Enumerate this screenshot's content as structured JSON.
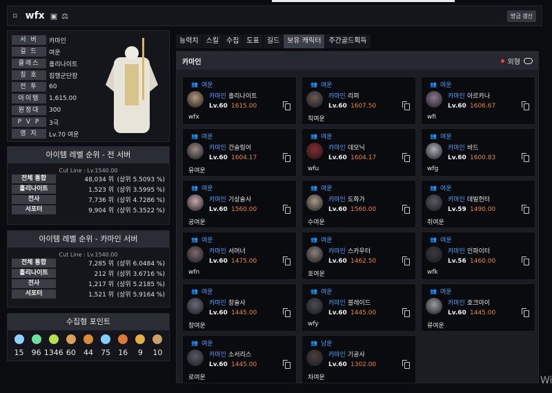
{
  "top": {
    "name": "wfx",
    "refresh": "방금 갱신"
  },
  "profile": [
    {
      "label": "서 버",
      "value": "카마인"
    },
    {
      "label": "길 드",
      "value": "여운"
    },
    {
      "label": "클래스",
      "value": "홀리나이트"
    },
    {
      "label": "칭 호",
      "value": "집행군단장"
    },
    {
      "label": "전 투",
      "value": "60"
    },
    {
      "label": "아이템",
      "value": "1,615.00"
    },
    {
      "label": "원정대",
      "value": "300"
    },
    {
      "label": "P V P",
      "value": "3극"
    },
    {
      "label": "영 지",
      "value": "Lv.70 여운"
    }
  ],
  "ranking_all": {
    "title": "아이템 레벨 순위 - 전 서버",
    "cut": "Cut Line : Lv.1540.00",
    "rows": [
      {
        "label": "전체 통합",
        "rank": "48,034 위",
        "pct": "(상위 5.5093 %)"
      },
      {
        "label": "홀리나이트",
        "rank": "1,523 위",
        "pct": "(상위 3.5995 %)"
      },
      {
        "label": "전사",
        "rank": "7,736 위",
        "pct": "(상위 4.7286 %)"
      },
      {
        "label": "서포터",
        "rank": "9,904 위",
        "pct": "(상위 5.3522 %)"
      }
    ]
  },
  "ranking_server": {
    "title": "아이템 레벨 순위 - 카마인 서버",
    "cut": "Cut Line : Lv.1540.00",
    "rows": [
      {
        "label": "전체 통합",
        "rank": "7,285 위",
        "pct": "(상위 6.0484 %)"
      },
      {
        "label": "홀리나이트",
        "rank": "212 위",
        "pct": "(상위 3.6716 %)"
      },
      {
        "label": "전사",
        "rank": "1,217 위",
        "pct": "(상위 5.2185 %)"
      },
      {
        "label": "서포터",
        "rank": "1,521 위",
        "pct": "(상위 5.9164 %)"
      }
    ]
  },
  "collect": {
    "title": "수집형 포인트",
    "items": [
      {
        "icon": "island-heart-icon",
        "value": "15",
        "color": "#8fd0ff"
      },
      {
        "icon": "orb-icon",
        "value": "96",
        "color": "#6ce0a0"
      },
      {
        "icon": "seed-icon",
        "value": "1346",
        "color": "#b6e04a"
      },
      {
        "icon": "art-icon",
        "value": "60",
        "color": "#d9a35a"
      },
      {
        "icon": "voyage-icon",
        "value": "44",
        "color": "#d98c3a"
      },
      {
        "icon": "star-icon",
        "value": "75",
        "color": "#7fd0ff"
      },
      {
        "icon": "wing-icon",
        "value": "16",
        "color": "#e07a3a"
      },
      {
        "icon": "sun-icon",
        "value": "9",
        "color": "#e0b040"
      },
      {
        "icon": "coin-icon",
        "value": "10",
        "color": "#c9a06a"
      }
    ]
  },
  "tabs": [
    "능력치",
    "스킬",
    "수집",
    "도표",
    "길드",
    "보유 캐릭터",
    "주간골드획득"
  ],
  "active_tab": 5,
  "roster": {
    "server": "카마인",
    "look_label": "외형",
    "characters": [
      {
        "guild": "여운",
        "server": "카마인",
        "class": "홀리나이트",
        "level": "Lv.60",
        "ilvl": "1615.00",
        "name": "wfx",
        "portrait": "#b49a7a"
      },
      {
        "guild": "여운",
        "server": "카마인",
        "class": "리퍼",
        "level": "Lv.60",
        "ilvl": "1607.50",
        "name": "칙여운",
        "portrait": "#6a5a55"
      },
      {
        "guild": "여운",
        "server": "카마인",
        "class": "아르카나",
        "level": "Lv.60",
        "ilvl": "1606.67",
        "name": "wfi",
        "portrait": "#8a7a90"
      },
      {
        "guild": "여운",
        "server": "카마인",
        "class": "건슬링어",
        "level": "Lv.60",
        "ilvl": "1604.17",
        "name": "유여운",
        "portrait": "#9c8a86"
      },
      {
        "guild": "여운",
        "server": "카마인",
        "class": "데모닉",
        "level": "Lv.60",
        "ilvl": "1604.17",
        "name": "wfu",
        "portrait": "#8a2a2a"
      },
      {
        "guild": "여운",
        "server": "카마인",
        "class": "바드",
        "level": "Lv.60",
        "ilvl": "1600.83",
        "name": "wfg",
        "portrait": "#b0b0b8"
      },
      {
        "guild": "여운",
        "server": "카마인",
        "class": "기상술사",
        "level": "Lv.60",
        "ilvl": "1560.00",
        "name": "공여운",
        "portrait": "#c8a8b0"
      },
      {
        "guild": "여운",
        "server": "카마인",
        "class": "도화가",
        "level": "Lv.60",
        "ilvl": "1560.00",
        "name": "수여운",
        "portrait": "#a89c88"
      },
      {
        "guild": "여운",
        "server": "카마인",
        "class": "데빌헌터",
        "level": "Lv.59",
        "ilvl": "1490.00",
        "name": "쥐여운",
        "portrait": "#5a5a60"
      },
      {
        "guild": "여운",
        "server": "카마인",
        "class": "서머너",
        "level": "Lv.60",
        "ilvl": "1475.00",
        "name": "wfn",
        "portrait": "#7a6a6a"
      },
      {
        "guild": "여운",
        "server": "카마인",
        "class": "스카우터",
        "level": "Lv.60",
        "ilvl": "1462.50",
        "name": "호여운",
        "portrait": "#8a8078"
      },
      {
        "guild": "여운",
        "server": "카마인",
        "class": "인파이터",
        "level": "Lv.56",
        "ilvl": "1460.00",
        "name": "wfk",
        "portrait": "#3a3a40"
      },
      {
        "guild": "여운",
        "server": "카마인",
        "class": "창술사",
        "level": "Lv.60",
        "ilvl": "1445.00",
        "name": "창여운",
        "portrait": "#6a6a78"
      },
      {
        "guild": "여운",
        "server": "카마인",
        "class": "블레이드",
        "level": "Lv.60",
        "ilvl": "1445.00",
        "name": "wfy",
        "portrait": "#4a4a50"
      },
      {
        "guild": "여운",
        "server": "카마인",
        "class": "호크아이",
        "level": "Lv.60",
        "ilvl": "1445.00",
        "name": "류여운",
        "portrait": "#9a9aa0"
      },
      {
        "guild": "여운",
        "server": "카마인",
        "class": "소서리스",
        "level": "Lv.60",
        "ilvl": "1445.00",
        "name": "로여운",
        "portrait": "#5a5a68"
      },
      {
        "guild": "낭운",
        "server": "카마인",
        "class": "기공사",
        "level": "Lv.60",
        "ilvl": "1302.00",
        "name": "차여운",
        "portrait": "#4a4040"
      }
    ]
  },
  "watermark": "Wi"
}
